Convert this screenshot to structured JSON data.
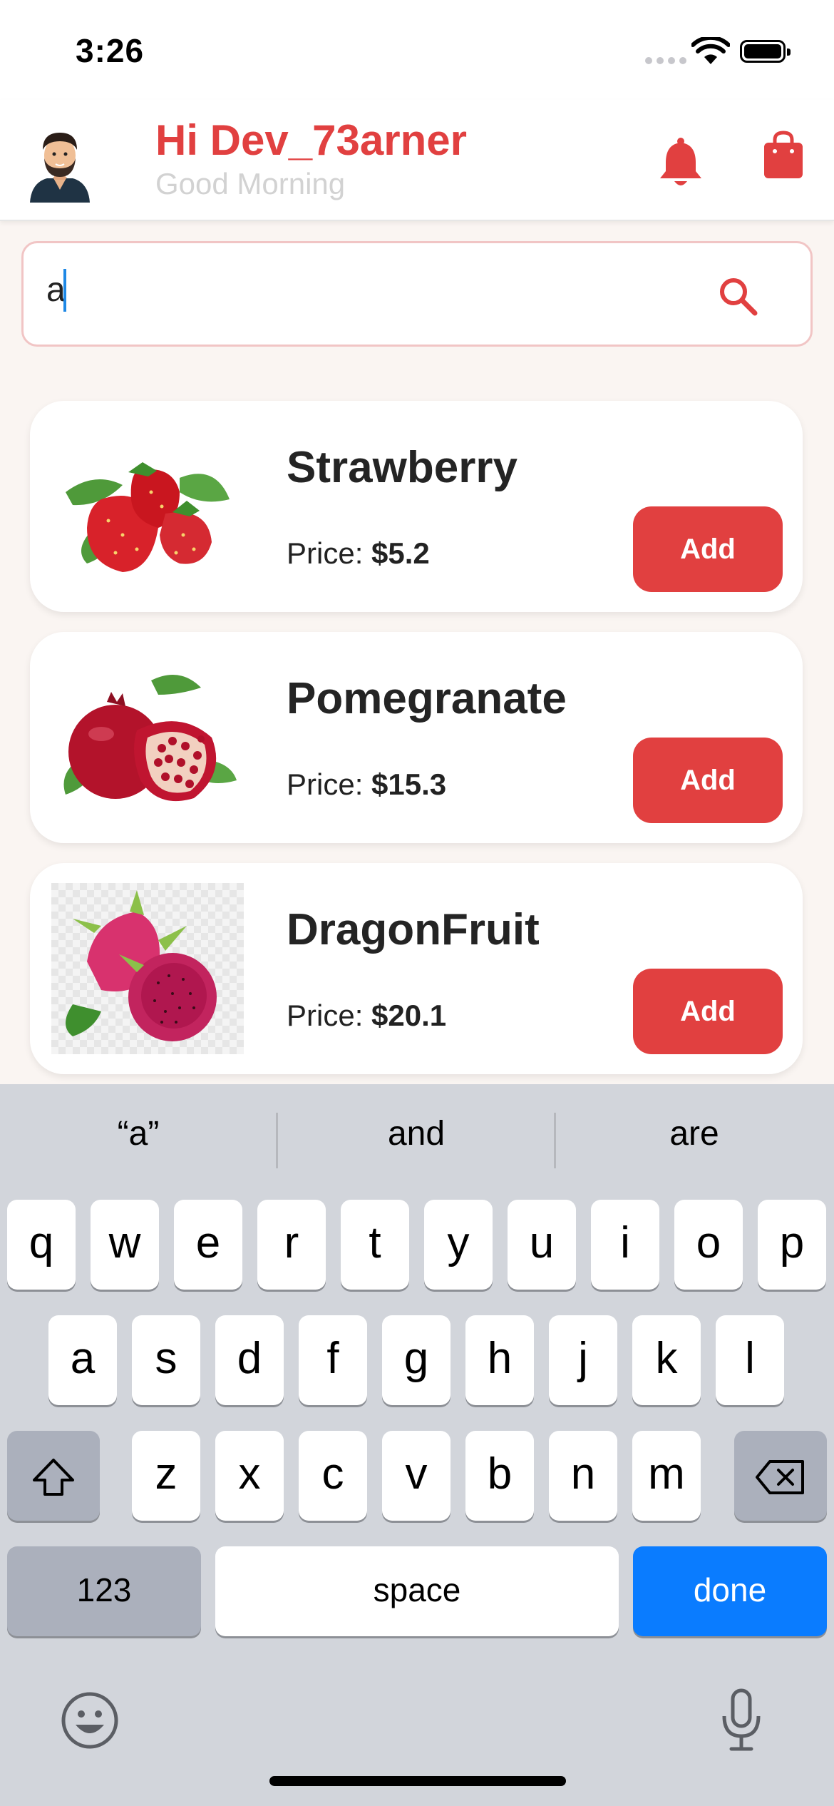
{
  "status_bar": {
    "time": "3:26"
  },
  "header": {
    "greeting": "Hi Dev_73arner",
    "subtitle": "Good Morning"
  },
  "search": {
    "value": "a"
  },
  "products": [
    {
      "name": "Strawberry",
      "price_label": "Price: ",
      "price": "$5.2",
      "add_label": "Add"
    },
    {
      "name": "Pomegranate",
      "price_label": "Price: ",
      "price": "$15.3",
      "add_label": "Add"
    },
    {
      "name": "DragonFruit",
      "price_label": "Price: ",
      "price": "$20.1",
      "add_label": "Add"
    }
  ],
  "keyboard": {
    "suggestions": [
      "“a”",
      "and",
      "are"
    ],
    "row1": [
      "q",
      "w",
      "e",
      "r",
      "t",
      "y",
      "u",
      "i",
      "o",
      "p"
    ],
    "row2": [
      "a",
      "s",
      "d",
      "f",
      "g",
      "h",
      "j",
      "k",
      "l"
    ],
    "row3": [
      "z",
      "x",
      "c",
      "v",
      "b",
      "n",
      "m"
    ],
    "numbers_key": "123",
    "space_key": "space",
    "done_key": "done"
  },
  "colors": {
    "accent": "#e14040",
    "done_blue": "#0a7cff"
  },
  "icons": [
    "wifi-icon",
    "battery-icon",
    "avatar",
    "bell-icon",
    "shopping-bag-icon",
    "search-icon",
    "shift-icon",
    "backspace-icon",
    "emoji-icon",
    "microphone-icon"
  ]
}
